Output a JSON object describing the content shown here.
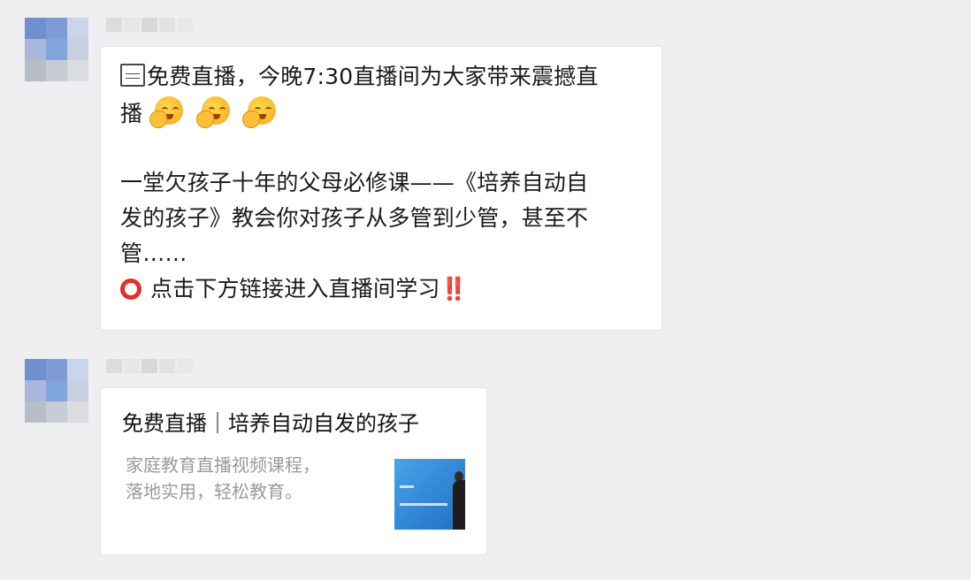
{
  "chat": {
    "message1": {
      "line1": "免费直播，今晚7:30直播间为大家带来震撼直",
      "line2": "播",
      "line3": "一堂欠孩子十年的父母必修课——《培养自动自",
      "line4": "发的孩子》教会你对孩子从多管到少管，甚至不",
      "line5": "管……",
      "line6": "点击下方链接进入直播间学习‼️",
      "icons": {
        "leading": "image-placeholder-icon",
        "emoji": "shy-face-emoji",
        "bullet": "red-circle-icon"
      }
    },
    "message2": {
      "title": "免费直播｜培养自动自发的孩子",
      "desc_line1": "家庭教育直播视频课程，",
      "desc_line2": "落地实用，轻松教育。"
    }
  },
  "colors": {
    "background": "#efeff1",
    "bubble": "#ffffff",
    "link_desc": "#9a9a9a",
    "red_circle": "#e0302a"
  }
}
